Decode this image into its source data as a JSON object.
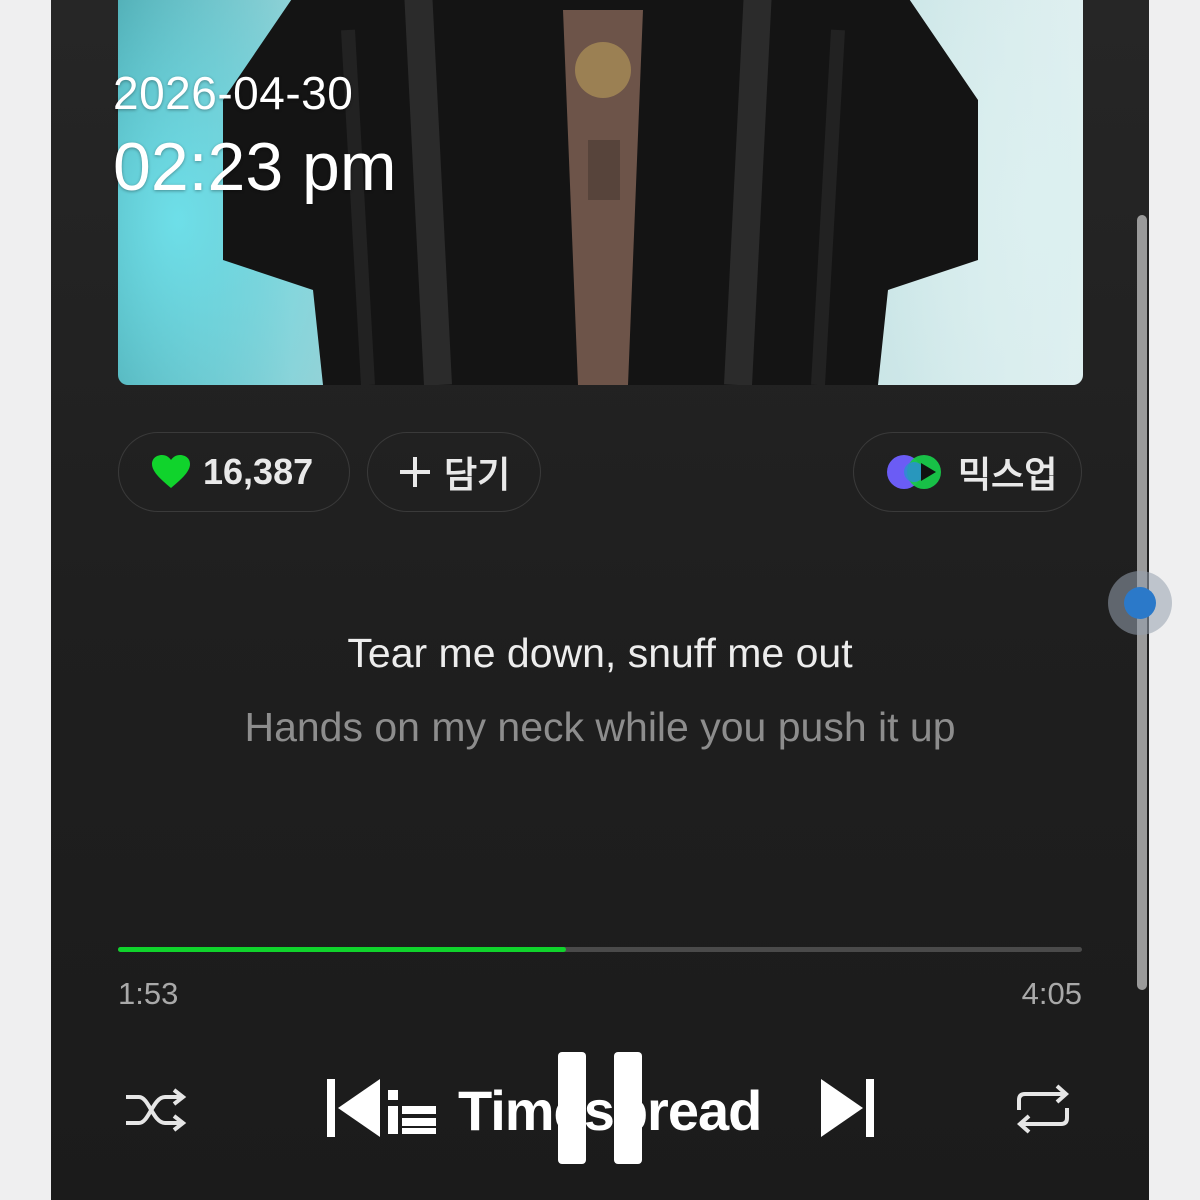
{
  "overlay": {
    "date": "2026-04-30",
    "time": "02:23 pm"
  },
  "actions": {
    "like_count": "16,387",
    "add_label": "담기",
    "mix_label": "믹스업"
  },
  "lyrics": {
    "current": "Tear me down, snuff me out",
    "next": "Hands on my neck while you push it up"
  },
  "player": {
    "elapsed": "1:53",
    "duration": "4:05",
    "progress_fraction": 0.465
  },
  "watermark": "Timespread",
  "colors": {
    "accent_green": "#10d32c",
    "background": "#1f1f1f",
    "knob_blue": "#2b79c9"
  },
  "icons": [
    "heart-icon",
    "plus-icon",
    "mixup-icon",
    "shuffle-icon",
    "previous-icon",
    "playlist-icon",
    "pause-icon",
    "next-icon",
    "repeat-icon"
  ]
}
